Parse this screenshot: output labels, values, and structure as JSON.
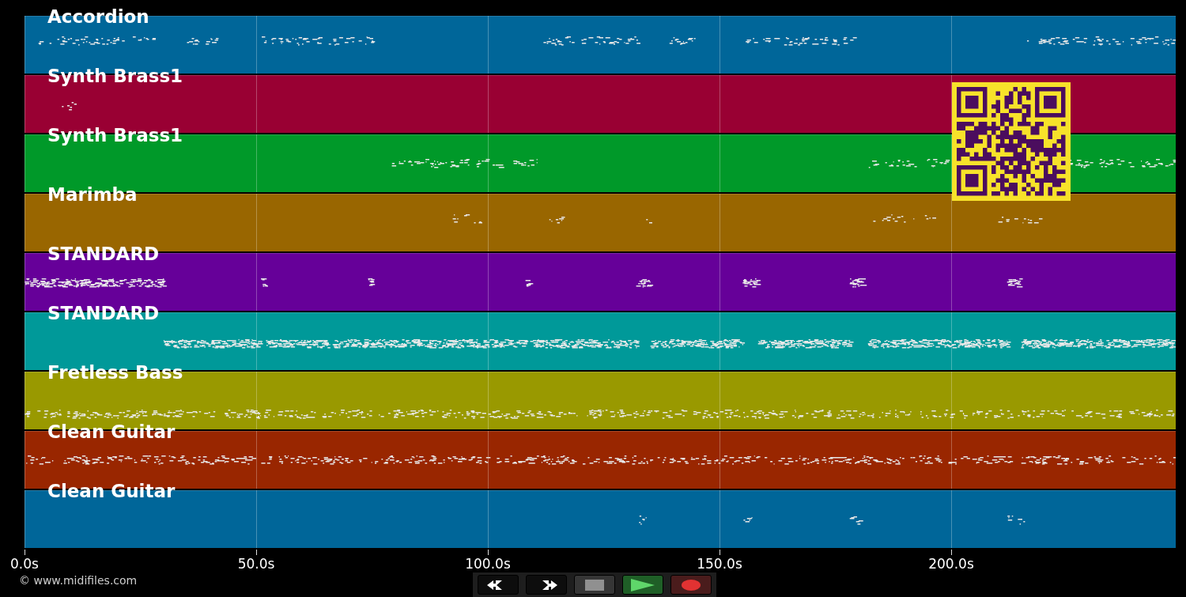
{
  "tracks": [
    {
      "name": "Accordion",
      "color": "#006699"
    },
    {
      "name": "Synth Brass1",
      "color": "#990033"
    },
    {
      "name": "Synth Brass1",
      "color": "#009929"
    },
    {
      "name": "Marimba",
      "color": "#996600"
    },
    {
      "name": "STANDARD",
      "color": "#660099"
    },
    {
      "name": "STANDARD",
      "color": "#009999"
    },
    {
      "name": "Fretless Bass",
      "color": "#999900"
    },
    {
      "name": "Clean Guitar",
      "color": "#992600"
    },
    {
      "name": "Clean Guitar",
      "color": "#006699"
    }
  ],
  "axis_ticks": [
    "0.0s",
    "50.0s",
    "100.0s",
    "150.0s",
    "200.0s"
  ],
  "copyright": "© www.midifiles.com",
  "controls": [
    {
      "kind": "rewind"
    },
    {
      "kind": "forward"
    },
    {
      "kind": "stop"
    },
    {
      "kind": "play"
    },
    {
      "kind": "record"
    }
  ]
}
